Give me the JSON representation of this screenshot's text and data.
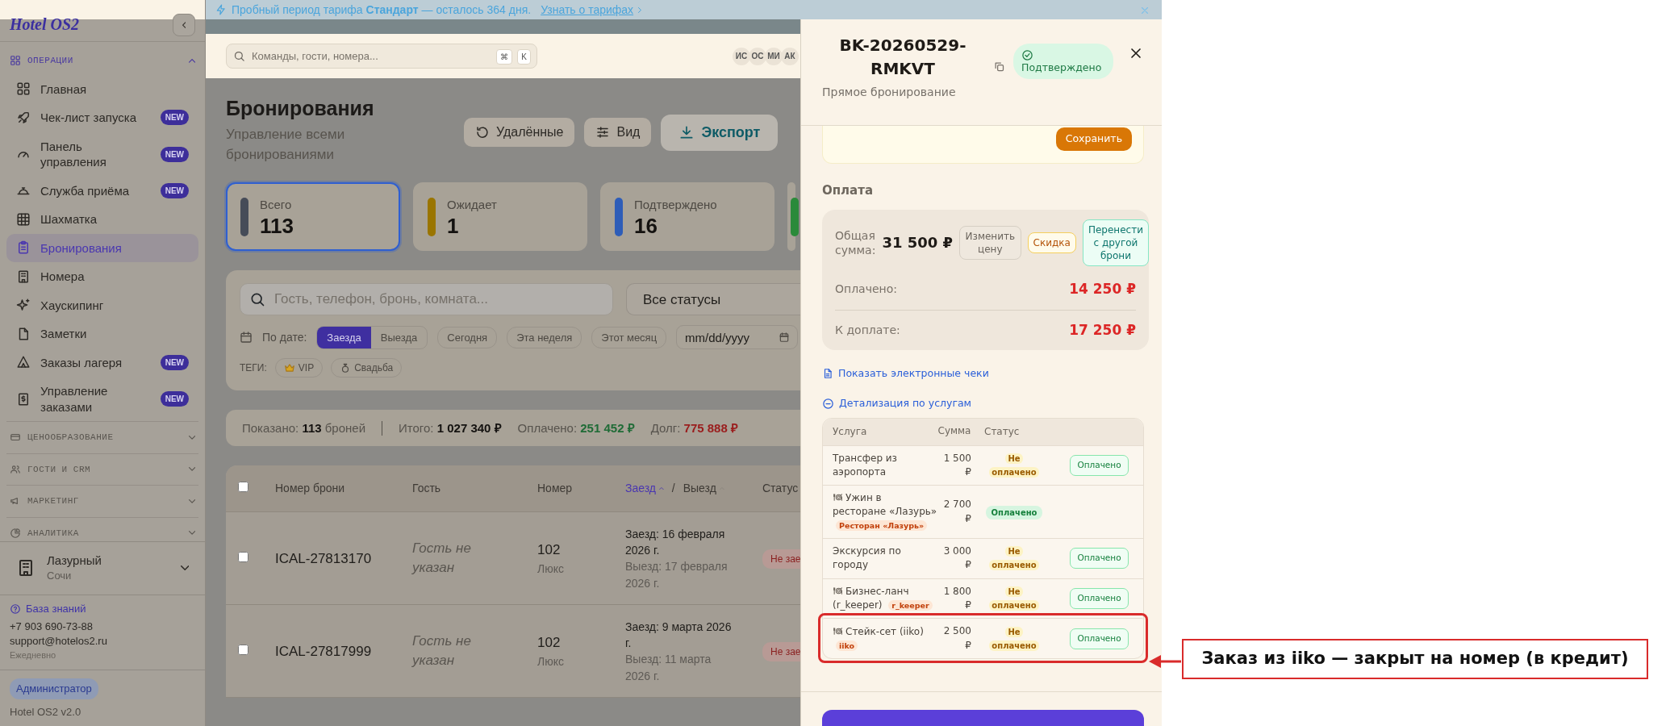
{
  "banner": {
    "text": "Пробный период тарифа **Стандарт** — осталось 364 дня.",
    "link": "Узнать о тарифах"
  },
  "sidebar": {
    "logo": "Hotel OS2",
    "sections": [
      {
        "title": "ОПЕРАЦИИ",
        "expanded": true,
        "items": [
          {
            "label": "Главная",
            "selected": false
          },
          {
            "label": "Чек-лист запуска",
            "badge": "NEW",
            "selected": false
          },
          {
            "label": "Панель управления",
            "badge": "NEW",
            "selected": false
          },
          {
            "label": "Служба приёма",
            "badge": "NEW",
            "selected": false
          },
          {
            "label": "Шахматка",
            "selected": false
          },
          {
            "label": "Бронирования",
            "selected": true
          },
          {
            "label": "Номера",
            "selected": false
          },
          {
            "label": "Хаускипинг",
            "selected": false
          },
          {
            "label": "Заметки",
            "selected": false
          },
          {
            "label": "Заказы лагеря",
            "badge": "NEW",
            "selected": false
          },
          {
            "label": "Управление заказами",
            "badge": "NEW",
            "selected": false
          }
        ]
      },
      {
        "title": "ЦЕНООБРАЗОВАНИЕ",
        "expanded": false
      },
      {
        "title": "ГОСТИ И CRM",
        "expanded": false
      },
      {
        "title": "МАРКЕТИНГ",
        "expanded": false
      },
      {
        "title": "АНАЛИТИКА",
        "expanded": false
      }
    ],
    "property": {
      "name": "Лазурный",
      "city": "Сочи"
    },
    "help": {
      "link": "База знаний",
      "phone": "+7 903 690-73-88",
      "email": "support@hotelos2.ru",
      "hours": "Ежедневно"
    },
    "role": "Администратор",
    "version": "Hotel OS2 v2.0"
  },
  "header": {
    "search_placeholder": "Команды, гости, номера...",
    "shortcut": [
      "⌘",
      "K"
    ],
    "avatars": [
      "ИС",
      "ОС",
      "МИ",
      "АК"
    ]
  },
  "page": {
    "title": "Бронирования",
    "subtitle": "Управление всеми бронированиями",
    "actions": [
      {
        "label": "Удалённые",
        "kind": "plain"
      },
      {
        "label": "Вид",
        "kind": "plain"
      },
      {
        "label": "Экспорт",
        "kind": "primary"
      }
    ]
  },
  "stats": [
    {
      "label": "Всего",
      "value": "113",
      "color": "#464c58",
      "selected": true
    },
    {
      "label": "Ожидает",
      "value": "1",
      "color": "#9a7500",
      "selected": false
    },
    {
      "label": "Подтверждено",
      "value": "16",
      "color": "#2e5db8",
      "selected": false
    },
    {
      "color": "#2a8a3a",
      "selected": false
    }
  ],
  "filters": {
    "search_placeholder": "Гость, телефон, бронь, комната...",
    "status": "Все статусы",
    "date_label": "По дате:",
    "date_modes": [
      {
        "label": "Заезда",
        "selected": true
      },
      {
        "label": "Выезда",
        "selected": false
      }
    ],
    "presets": [
      {
        "label": "Сегодня",
        "selected": false
      },
      {
        "label": "Эта неделя",
        "selected": false
      },
      {
        "label": "Этот месяц",
        "selected": false
      }
    ],
    "date_placeholder": "mm/dd/yyyy",
    "tags_label": "ТЕГИ:",
    "tags": [
      {
        "label": "VIP"
      },
      {
        "label": "Свадьба"
      }
    ]
  },
  "summary": [
    {
      "label": "Показано:",
      "value": "113",
      "suffix": "броней",
      "color": "#141210",
      "divider": true
    },
    {
      "label": "Итого:",
      "value": "1 027 340 ₽",
      "color": "#141210",
      "divider": false
    },
    {
      "label": "Оплачено:",
      "value": "251 452 ₽",
      "color": "#1f6b36",
      "divider": false
    },
    {
      "label": "Долг:",
      "value": "775 888 ₽",
      "color": "#9a1c1c",
      "divider": false
    }
  ],
  "table": {
    "header_checked": false,
    "columns": [
      {
        "kind": "text",
        "label": "Номер брони"
      },
      {
        "kind": "text",
        "label": "Гость"
      },
      {
        "kind": "text",
        "label": "Номер"
      },
      {
        "kind": "sort",
        "separator": "/",
        "labels": [
          {
            "label": "Заезд",
            "selected": true
          },
          {
            "label": "Выезд",
            "selected": false
          }
        ]
      },
      {
        "kind": "text",
        "label": "Статус"
      }
    ],
    "rows": [
      {
        "checked": false,
        "id": "ICAL-27813170",
        "guest": "Гость не указан",
        "room": "102",
        "room_type": "Люкс",
        "checkin": "Заезд: 16 февраля 2026 г.",
        "checkout": "Выезд: 17 февраля 2026 г.",
        "status": "Не зае"
      },
      {
        "checked": false,
        "id": "ICAL-27817999",
        "guest": "Гость не указан",
        "room": "102",
        "room_type": "Люкс",
        "checkin": "Заезд: 9 марта 2026 г.",
        "checkout": "Выезд: 11 марта 2026 г.",
        "status": "Не зае"
      }
    ]
  },
  "drawer": {
    "title": "BK-20260529-RMKVT",
    "status": "Подтверждено",
    "subtitle": "Прямое бронирование",
    "save": "Сохранить",
    "payment": {
      "heading": "Оплата",
      "total_label": "Общая сумма:",
      "total": "31 500 ₽",
      "actions": [
        {
          "label": "Изменить цену",
          "kind": "neutral"
        },
        {
          "label": "Скидка",
          "kind": "warning"
        },
        {
          "label": "Перенести с другой брони",
          "kind": "success"
        }
      ],
      "paid_label": "Оплачено:",
      "paid": "14 250 ₽",
      "due_label": "К доплате:",
      "due": "17 250 ₽"
    },
    "receipts_link": "Показать электронные чеки",
    "breakdown": {
      "title": "Детализация по услугам",
      "expanded": true,
      "columns": [
        "Услуга",
        "Сумма",
        "Статус"
      ],
      "rows": [
        {
          "kind": "service",
          "name": "Трансфер из аэропорта",
          "amount": "1 500 ₽",
          "status": "Не оплачено",
          "paid": false,
          "action": "Оплачено",
          "highlighted": false
        },
        {
          "kind": "restaurant",
          "name": "Ужин в ресторане «Лазурь»",
          "tag": "Ресторан «Лазурь»",
          "amount": "2 700 ₽",
          "status": "Оплачено",
          "paid": true,
          "highlighted": false
        },
        {
          "kind": "service",
          "name": "Экскурсия по городу",
          "amount": "3 000 ₽",
          "status": "Не оплачено",
          "paid": false,
          "action": "Оплачено",
          "highlighted": false
        },
        {
          "kind": "restaurant",
          "name": "Бизнес-ланч (r_keeper)",
          "tag": "r_keeper",
          "amount": "1 800 ₽",
          "status": "Не оплачено",
          "paid": false,
          "action": "Оплачено",
          "highlighted": false
        },
        {
          "kind": "restaurant",
          "name": "Стейк-сет (iiko)",
          "tag": "iiko",
          "amount": "2 500 ₽",
          "status": "Не оплачено",
          "paid": false,
          "action": "Оплачено",
          "highlighted": true
        }
      ]
    }
  },
  "callout": "Заказ из iiko — закрыт на номер (в кредит)"
}
